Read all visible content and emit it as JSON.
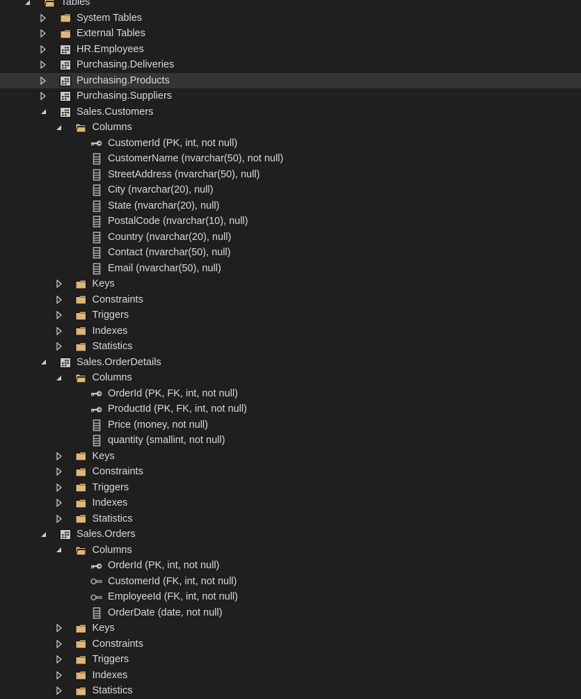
{
  "colors": {
    "background": "#1f1f1f",
    "selected_row": "#353535",
    "text": "#d8d8d8",
    "folder": "#dcb67a",
    "icon_gray": "#c8c8c8"
  },
  "tree": [
    {
      "level": 0,
      "state": "expanded",
      "icon": "folder-open-icon",
      "label": "Tables"
    },
    {
      "level": 1,
      "state": "collapsed",
      "icon": "folder-icon",
      "label": "System Tables"
    },
    {
      "level": 1,
      "state": "collapsed",
      "icon": "folder-icon",
      "label": "External Tables"
    },
    {
      "level": 1,
      "state": "collapsed",
      "icon": "table-icon",
      "label": "HR.Employees"
    },
    {
      "level": 1,
      "state": "collapsed",
      "icon": "table-icon",
      "label": "Purchasing.Deliveries"
    },
    {
      "level": 1,
      "state": "collapsed",
      "icon": "table-icon",
      "label": "Purchasing.Products",
      "selected": true
    },
    {
      "level": 1,
      "state": "collapsed",
      "icon": "table-icon",
      "label": "Purchasing.Suppliers"
    },
    {
      "level": 1,
      "state": "expanded",
      "icon": "table-icon",
      "label": "Sales.Customers"
    },
    {
      "level": 2,
      "state": "expanded",
      "icon": "folder-open-icon",
      "label": "Columns"
    },
    {
      "level": 3,
      "state": "leaf",
      "icon": "primary-key-icon",
      "label": "CustomerId (PK, int, not null)"
    },
    {
      "level": 3,
      "state": "leaf",
      "icon": "column-icon",
      "label": "CustomerName (nvarchar(50), not null)"
    },
    {
      "level": 3,
      "state": "leaf",
      "icon": "column-icon",
      "label": "StreetAddress (nvarchar(50), null)"
    },
    {
      "level": 3,
      "state": "leaf",
      "icon": "column-icon",
      "label": "City (nvarchar(20), null)"
    },
    {
      "level": 3,
      "state": "leaf",
      "icon": "column-icon",
      "label": "State (nvarchar(20), null)"
    },
    {
      "level": 3,
      "state": "leaf",
      "icon": "column-icon",
      "label": "PostalCode (nvarchar(10), null)"
    },
    {
      "level": 3,
      "state": "leaf",
      "icon": "column-icon",
      "label": "Country (nvarchar(20), null)"
    },
    {
      "level": 3,
      "state": "leaf",
      "icon": "column-icon",
      "label": "Contact (nvarchar(50), null)"
    },
    {
      "level": 3,
      "state": "leaf",
      "icon": "column-icon",
      "label": "Email (nvarchar(50), null)"
    },
    {
      "level": 2,
      "state": "collapsed",
      "icon": "folder-icon",
      "label": "Keys"
    },
    {
      "level": 2,
      "state": "collapsed",
      "icon": "folder-icon",
      "label": "Constraints"
    },
    {
      "level": 2,
      "state": "collapsed",
      "icon": "folder-icon",
      "label": "Triggers"
    },
    {
      "level": 2,
      "state": "collapsed",
      "icon": "folder-icon",
      "label": "Indexes"
    },
    {
      "level": 2,
      "state": "collapsed",
      "icon": "folder-icon",
      "label": "Statistics"
    },
    {
      "level": 1,
      "state": "expanded",
      "icon": "table-icon",
      "label": "Sales.OrderDetails"
    },
    {
      "level": 2,
      "state": "expanded",
      "icon": "folder-open-icon",
      "label": "Columns"
    },
    {
      "level": 3,
      "state": "leaf",
      "icon": "primary-key-icon",
      "label": "OrderId (PK, FK, int, not null)"
    },
    {
      "level": 3,
      "state": "leaf",
      "icon": "primary-key-icon",
      "label": "ProductId (PK, FK, int, not null)"
    },
    {
      "level": 3,
      "state": "leaf",
      "icon": "column-icon",
      "label": "Price (money, not null)"
    },
    {
      "level": 3,
      "state": "leaf",
      "icon": "column-icon",
      "label": "quantity (smallint, not null)"
    },
    {
      "level": 2,
      "state": "collapsed",
      "icon": "folder-icon",
      "label": "Keys"
    },
    {
      "level": 2,
      "state": "collapsed",
      "icon": "folder-icon",
      "label": "Constraints"
    },
    {
      "level": 2,
      "state": "collapsed",
      "icon": "folder-icon",
      "label": "Triggers"
    },
    {
      "level": 2,
      "state": "collapsed",
      "icon": "folder-icon",
      "label": "Indexes"
    },
    {
      "level": 2,
      "state": "collapsed",
      "icon": "folder-icon",
      "label": "Statistics"
    },
    {
      "level": 1,
      "state": "expanded",
      "icon": "table-icon",
      "label": "Sales.Orders"
    },
    {
      "level": 2,
      "state": "expanded",
      "icon": "folder-open-icon",
      "label": "Columns"
    },
    {
      "level": 3,
      "state": "leaf",
      "icon": "primary-key-icon",
      "label": "OrderId (PK, int, not null)"
    },
    {
      "level": 3,
      "state": "leaf",
      "icon": "foreign-key-icon",
      "label": "CustomerId (FK, int, not null)"
    },
    {
      "level": 3,
      "state": "leaf",
      "icon": "foreign-key-icon",
      "label": "EmployeeId (FK, int, not null)"
    },
    {
      "level": 3,
      "state": "leaf",
      "icon": "column-icon",
      "label": "OrderDate (date, not null)"
    },
    {
      "level": 2,
      "state": "collapsed",
      "icon": "folder-icon",
      "label": "Keys"
    },
    {
      "level": 2,
      "state": "collapsed",
      "icon": "folder-icon",
      "label": "Constraints"
    },
    {
      "level": 2,
      "state": "collapsed",
      "icon": "folder-icon",
      "label": "Triggers"
    },
    {
      "level": 2,
      "state": "collapsed",
      "icon": "folder-icon",
      "label": "Indexes"
    },
    {
      "level": 2,
      "state": "collapsed",
      "icon": "folder-icon",
      "label": "Statistics"
    }
  ]
}
